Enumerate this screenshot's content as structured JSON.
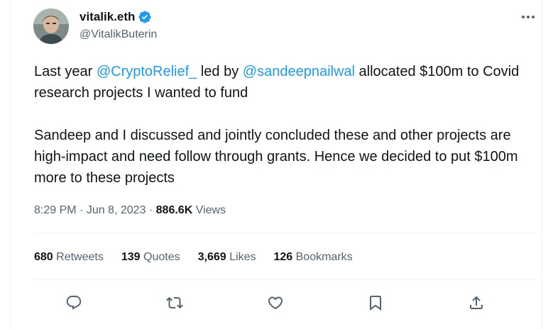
{
  "author": {
    "display_name": "vitalik.eth",
    "handle": "@VitalikButerin",
    "verified_color": "#1d9bf0"
  },
  "tweet": {
    "p1_before": "Last year ",
    "mention1": "@CryptoRelief_",
    "p1_mid": " led by ",
    "mention2": "@sandeepnailwal",
    "p1_after": " allocated $100m to Covid research projects I wanted to fund",
    "p2": "Sandeep and I discussed and jointly concluded these and other projects are high-impact and need follow through grants. Hence we decided to put $100m more to these projects"
  },
  "meta": {
    "time": "8:29 PM",
    "sep1": " · ",
    "date": "Jun 8, 2023",
    "sep2": " · ",
    "views_count": "886.6K",
    "views_label": " Views"
  },
  "stats": {
    "retweets_count": "680",
    "retweets_label": "Retweets",
    "quotes_count": "139",
    "quotes_label": "Quotes",
    "likes_count": "3,669",
    "likes_label": "Likes",
    "bookmarks_count": "126",
    "bookmarks_label": "Bookmarks"
  },
  "actions": {
    "icons": [
      "reply-icon",
      "retweet-icon",
      "like-icon",
      "bookmark-icon",
      "share-icon"
    ]
  },
  "colors": {
    "link": "#1d9bf0",
    "secondary_text": "#536471",
    "primary_text": "#0f1419",
    "divider": "#eff3f4"
  }
}
